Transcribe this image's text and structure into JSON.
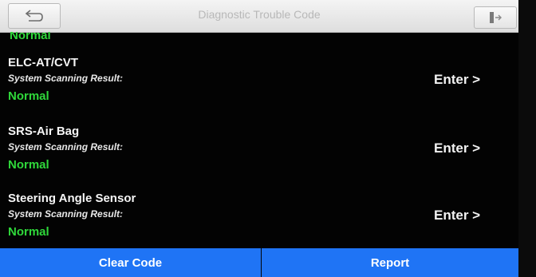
{
  "header": {
    "title": "Diagnostic Trouble Code",
    "back_icon": "back-arrow-icon",
    "exit_icon": "exit-icon"
  },
  "list": {
    "top_status": "Normal",
    "items": [
      {
        "name": "ELC-AT/CVT",
        "result_label": "System Scanning Result:",
        "status": "Normal",
        "enter_label": "Enter >"
      },
      {
        "name": "SRS-Air Bag",
        "result_label": "System Scanning Result:",
        "status": "Normal",
        "enter_label": "Enter >"
      },
      {
        "name": "Steering Angle Sensor",
        "result_label": "System Scanning Result:",
        "status": "Normal",
        "enter_label": "Enter >"
      }
    ]
  },
  "footer": {
    "clear_label": "Clear Code",
    "report_label": "Report"
  },
  "colors": {
    "status_normal": "#2fd83a",
    "button_blue": "#1f74f5",
    "background": "#030303"
  }
}
